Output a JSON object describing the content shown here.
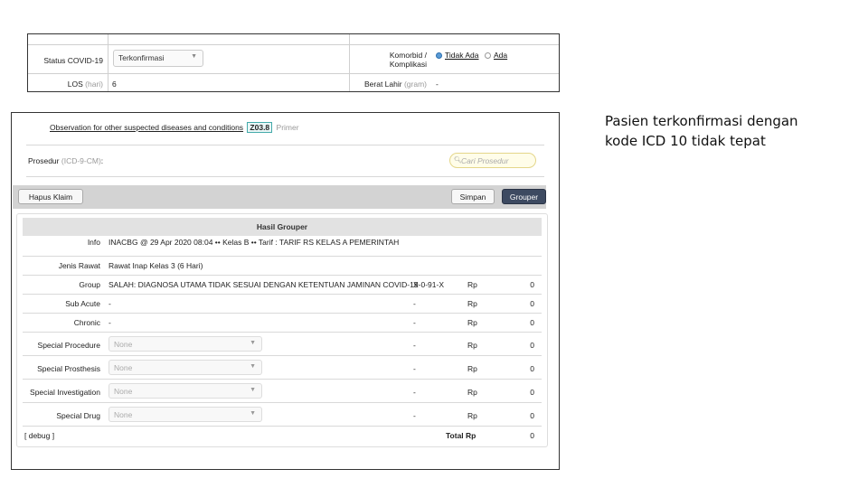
{
  "top_form": {
    "status_label": "Status COVID-19",
    "status_value": "Terkonfirmasi",
    "komorbid_label_1": "Komorbid /",
    "komorbid_label_2": "Komplikasi",
    "komorbid_options": [
      "Tidak Ada",
      "Ada"
    ],
    "komorbid_selected": "Tidak Ada",
    "los_label": "LOS",
    "los_unit": "(hari)",
    "los_value": "6",
    "berat_label": "Berat Lahir",
    "berat_unit": "(gram)",
    "berat_value": "-"
  },
  "observation": {
    "text": "Observation for other suspected diseases and conditions",
    "code": "Z03.8",
    "type": "Primer"
  },
  "procedure": {
    "label": "Prosedur",
    "label_muted": "(ICD-9-CM)",
    "colon": ":",
    "search_placeholder": "Cari Prosedur"
  },
  "toolbar": {
    "hapus_label": "Hapus Klaim",
    "simpan_label": "Simpan",
    "grouper_label": "Grouper"
  },
  "result": {
    "title": "Hasil Grouper",
    "rows": [
      {
        "label": "Info",
        "value": "INACBG @ 29 Apr 2020 08:04 •• Kelas B •• Tarif : TARIF RS KELAS A PEMERINTAH"
      },
      {
        "label": "Jenis Rawat",
        "value": "Rawat Inap Kelas 3 (6 Hari)"
      },
      {
        "label": "Group",
        "value": "SALAH: DIAGNOSA UTAMA TIDAK SESUAI DENGAN KETENTUAN JAMINAN COVID-19",
        "code": "X-0-91-X",
        "rp": "Rp",
        "amount": "0"
      },
      {
        "label": "Sub Acute",
        "value": "-",
        "code": "-",
        "rp": "Rp",
        "amount": "0"
      },
      {
        "label": "Chronic",
        "value": "-",
        "code": "-",
        "rp": "Rp",
        "amount": "0"
      },
      {
        "label": "Special Procedure",
        "select": "None",
        "code": "-",
        "rp": "Rp",
        "amount": "0"
      },
      {
        "label": "Special Prosthesis",
        "select": "None",
        "code": "-",
        "rp": "Rp",
        "amount": "0"
      },
      {
        "label": "Special Investigation",
        "select": "None",
        "code": "-",
        "rp": "Rp",
        "amount": "0"
      },
      {
        "label": "Special Drug",
        "select": "None",
        "code": "-",
        "rp": "Rp",
        "amount": "0"
      }
    ],
    "debug_label": "[ debug ]",
    "total_label": "Total Rp",
    "total_amount": "0"
  },
  "annotation": {
    "line1": "Pasien terkonfirmasi dengan",
    "line2": "kode ICD 10 tidak tepat"
  }
}
